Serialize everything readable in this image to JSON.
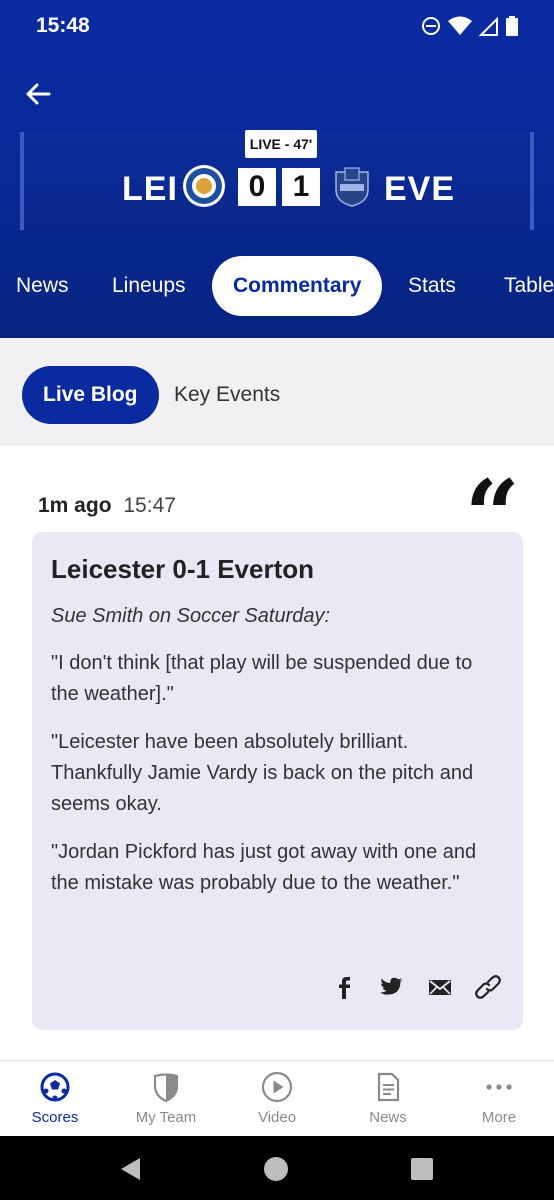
{
  "status_bar": {
    "time": "15:48"
  },
  "match": {
    "status": "LIVE - 47'",
    "home": {
      "code": "LEI",
      "score": "0",
      "badge_color": "#1d4ea0"
    },
    "away": {
      "code": "EVE",
      "score": "1",
      "badge_color": "#274488"
    }
  },
  "tabs": [
    {
      "label": "News"
    },
    {
      "label": "Lineups"
    },
    {
      "label": "Commentary",
      "active": true
    },
    {
      "label": "Stats"
    },
    {
      "label": "Table"
    }
  ],
  "subtabs": {
    "active": "Live Blog",
    "inactive": "Key Events"
  },
  "post": {
    "ago": "1m ago",
    "time": "15:47",
    "title": "Leicester 0-1 Everton",
    "attribution": "Sue Smith on Soccer Saturday:",
    "paragraphs": [
      "\"I don't think [that play will be suspended due to the weather].\"",
      "\"Leicester have been absolutely brilliant. Thankfully Jamie Vardy is back on the pitch and seems okay.",
      "\"Jordan Pickford has just got away with one and the mistake was probably due to the weather.\""
    ],
    "share_icons": [
      "facebook-icon",
      "twitter-icon",
      "email-icon",
      "link-icon"
    ]
  },
  "bottom_nav": [
    {
      "label": "Scores",
      "icon": "football-icon",
      "active": true
    },
    {
      "label": "My Team",
      "icon": "shield-icon"
    },
    {
      "label": "Video",
      "icon": "play-icon"
    },
    {
      "label": "News",
      "icon": "document-icon"
    },
    {
      "label": "More",
      "icon": "more-icon"
    }
  ],
  "colors": {
    "brand": "#0a2aa0",
    "card": "#e8e9f4"
  }
}
